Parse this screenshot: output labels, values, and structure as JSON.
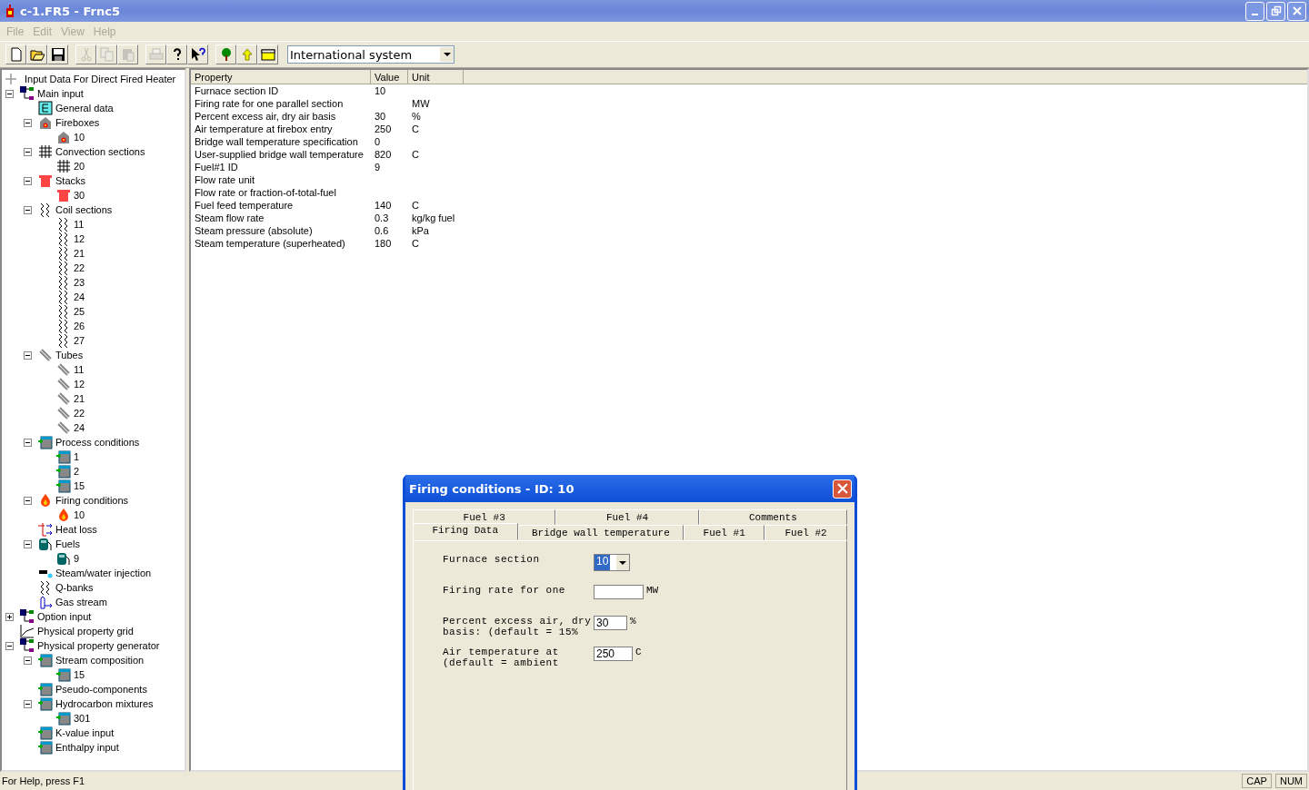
{
  "window": {
    "title": "c-1.FR5 - Frnc5"
  },
  "menu": [
    "File",
    "Edit",
    "View",
    "Help"
  ],
  "toolbar": [
    {
      "kind": "new",
      "disabled": false
    },
    {
      "kind": "open",
      "disabled": false
    },
    {
      "kind": "save",
      "disabled": false
    },
    {
      "kind": "cut",
      "disabled": true
    },
    {
      "kind": "copy",
      "disabled": true
    },
    {
      "kind": "paste",
      "disabled": true
    },
    {
      "kind": "print",
      "disabled": true
    },
    {
      "kind": "help",
      "disabled": false
    },
    {
      "kind": "context-help",
      "disabled": false
    },
    {
      "kind": "tree",
      "disabled": false
    },
    {
      "kind": "up",
      "disabled": false
    },
    {
      "kind": "folder",
      "disabled": false
    }
  ],
  "unit_system": {
    "value": "International system"
  },
  "tree": {
    "label": "Input Data For Direct Fired Heater",
    "children": [
      {
        "label": "Main input",
        "kind": "branch",
        "expanded": true,
        "children": [
          {
            "label": "General data",
            "kind": "doc"
          },
          {
            "label": "Fireboxes",
            "kind": "firebox",
            "expanded": true,
            "children": [
              {
                "label": "10",
                "kind": "firebox"
              }
            ]
          },
          {
            "label": "Convection sections",
            "kind": "convection",
            "expanded": true,
            "children": [
              {
                "label": "20",
                "kind": "convection"
              }
            ]
          },
          {
            "label": "Stacks",
            "kind": "stack",
            "expanded": true,
            "children": [
              {
                "label": "30",
                "kind": "stack"
              }
            ]
          },
          {
            "label": "Coil sections",
            "kind": "coil",
            "expanded": true,
            "children": [
              {
                "label": "11",
                "kind": "coil"
              },
              {
                "label": "12",
                "kind": "coil"
              },
              {
                "label": "21",
                "kind": "coil"
              },
              {
                "label": "22",
                "kind": "coil"
              },
              {
                "label": "23",
                "kind": "coil"
              },
              {
                "label": "24",
                "kind": "coil"
              },
              {
                "label": "25",
                "kind": "coil"
              },
              {
                "label": "26",
                "kind": "coil"
              },
              {
                "label": "27",
                "kind": "coil"
              }
            ]
          },
          {
            "label": "Tubes",
            "kind": "tube",
            "expanded": true,
            "children": [
              {
                "label": "11",
                "kind": "tube"
              },
              {
                "label": "12",
                "kind": "tube"
              },
              {
                "label": "21",
                "kind": "tube"
              },
              {
                "label": "22",
                "kind": "tube"
              },
              {
                "label": "24",
                "kind": "tube"
              }
            ]
          },
          {
            "label": "Process conditions",
            "kind": "table",
            "expanded": true,
            "children": [
              {
                "label": "1",
                "kind": "table"
              },
              {
                "label": "2",
                "kind": "table"
              },
              {
                "label": "15",
                "kind": "table"
              }
            ]
          },
          {
            "label": "Firing conditions",
            "kind": "flame",
            "expanded": true,
            "children": [
              {
                "label": "10",
                "kind": "flame"
              }
            ]
          },
          {
            "label": "Heat loss",
            "kind": "heatloss"
          },
          {
            "label": "Fuels",
            "kind": "fuel",
            "expanded": true,
            "children": [
              {
                "label": "9",
                "kind": "fuel"
              }
            ]
          },
          {
            "label": "Steam/water injection",
            "kind": "steam"
          },
          {
            "label": "Q-banks",
            "kind": "coil"
          },
          {
            "label": "Gas stream",
            "kind": "gas"
          }
        ]
      },
      {
        "label": "Option input",
        "kind": "branch",
        "expanded": false
      },
      {
        "label": "Physical property grid",
        "kind": "grid"
      },
      {
        "label": "Physical property generator",
        "kind": "branch",
        "expanded": true,
        "children": [
          {
            "label": "Stream composition",
            "kind": "table",
            "expanded": true,
            "children": [
              {
                "label": "15",
                "kind": "table"
              }
            ]
          },
          {
            "label": "Pseudo-components",
            "kind": "table"
          },
          {
            "label": "Hydrocarbon mixtures",
            "kind": "table",
            "expanded": true,
            "children": [
              {
                "label": "301",
                "kind": "table"
              }
            ]
          },
          {
            "label": "K-value input",
            "kind": "table"
          },
          {
            "label": "Enthalpy input",
            "kind": "table"
          }
        ]
      }
    ]
  },
  "table": {
    "columns": [
      "Property",
      "Value",
      "Unit"
    ],
    "rows": [
      [
        "Furnace section ID",
        "10",
        null
      ],
      [
        "Firing rate for one parallel section",
        null,
        "MW"
      ],
      [
        "Percent excess air, dry air basis",
        "30",
        "%"
      ],
      [
        "Air temperature at firebox entry",
        "250",
        "C"
      ],
      [
        "Bridge wall temperature specification",
        "0",
        null
      ],
      [
        "User-supplied bridge wall temperature",
        "820",
        "C"
      ],
      [
        "Fuel#1 ID",
        "9",
        null
      ],
      [
        "Flow rate unit",
        null,
        null
      ],
      [
        "Flow rate or fraction-of-total-fuel",
        null,
        null
      ],
      [
        "Fuel feed temperature",
        "140",
        "C"
      ],
      [
        "Steam flow rate",
        "0.3",
        "kg/kg fuel"
      ],
      [
        "Steam pressure (absolute)",
        "0.6",
        "kPa"
      ],
      [
        "Steam temperature (superheated)",
        "180",
        "C"
      ]
    ]
  },
  "dialog": {
    "title": "Firing conditions - ID: 10",
    "tab_rows": [
      [
        {
          "label": "Fuel #3",
          "selected": false
        },
        {
          "label": "Fuel #4",
          "selected": false
        },
        {
          "label": "Comments",
          "selected": false
        }
      ],
      [
        {
          "label": "Firing Data",
          "selected": true
        },
        {
          "label": "Bridge wall temperature",
          "selected": false
        },
        {
          "label": "Fuel #1",
          "selected": false
        },
        {
          "label": "Fuel #2",
          "selected": false
        }
      ]
    ],
    "fields": [
      {
        "kind": "dropdown",
        "label": [
          "Furnace section"
        ],
        "value": "10"
      },
      {
        "kind": "text",
        "label": [
          "Firing rate for one"
        ],
        "unit": "MW"
      },
      {
        "kind": "text",
        "label": [
          "Percent excess air, dry",
          "basis: (default = 15%"
        ],
        "value": "30",
        "unit": "%"
      },
      {
        "kind": "text",
        "label": [
          "Air temperature at",
          "(default = ambient"
        ],
        "value": "250",
        "unit": "C"
      }
    ]
  },
  "status_bar": {
    "message": "For Help, press F1",
    "indicators": [
      "CAP",
      "NUM"
    ]
  }
}
